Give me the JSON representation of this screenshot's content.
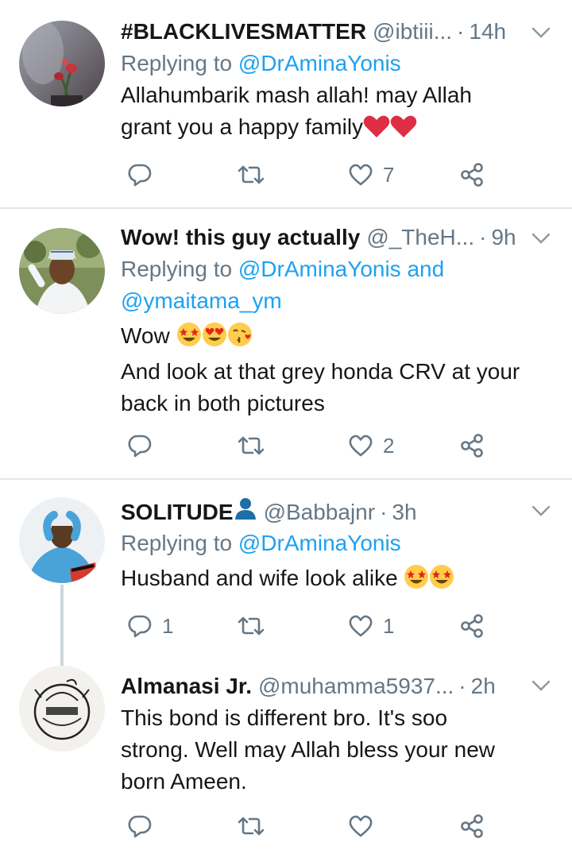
{
  "tweets": [
    {
      "display_name": "#BLACKLIVESMATTER",
      "handle": "@ibtiii...",
      "separator": "·",
      "time": "14h",
      "replying_to_label": "Replying to",
      "replying_to": "@DrAminaYonis",
      "text_lines": [
        "Allahumbarik mash allah! may Allah",
        "grant you a happy family"
      ],
      "trailing_emoji": [
        "red-heart",
        "red-heart"
      ],
      "reply_count": "",
      "retweet_count": "",
      "like_count": "7"
    },
    {
      "display_name": "Wow! this guy actually",
      "handle": "@_TheH...",
      "separator": "·",
      "time": "9h",
      "replying_to_label": "Replying to",
      "replying_to": "@DrAminaYonis",
      "replying_to_and": "and",
      "replying_to_second": "@ymaitama_ym",
      "text_lines": [
        "Wow",
        "And look at that grey honda CRV at your",
        "back in both pictures"
      ],
      "trailing_emoji": [
        "star-struck",
        "heart-eyes",
        "face-blowing-kiss"
      ],
      "reply_count": "",
      "retweet_count": "",
      "like_count": "2"
    },
    {
      "display_name": "SOLITUDE",
      "name_emoji": "bust-in-silhouette",
      "handle": "@Babbajnr",
      "separator": "·",
      "time": "3h",
      "replying_to_label": "Replying to",
      "replying_to": "@DrAminaYonis",
      "text_lines": [
        "Husband and wife look alike"
      ],
      "trailing_emoji": [
        "star-struck",
        "star-struck"
      ],
      "reply_count": "1",
      "retweet_count": "",
      "like_count": "1"
    },
    {
      "display_name": "Almanasi Jr.",
      "handle": "@muhamma5937...",
      "separator": "·",
      "time": "2h",
      "text_lines": [
        "This bond is different bro. It's soo",
        "strong. Well may Allah bless your new",
        "born Ameen."
      ],
      "reply_count": "",
      "retweet_count": "",
      "like_count": ""
    }
  ],
  "icons": {
    "reply": "reply-icon",
    "retweet": "retweet-icon",
    "like": "heart-icon",
    "share": "share-icon",
    "more": "chevron-down-icon"
  },
  "colors": {
    "link": "#1da1f2",
    "secondary_text": "#657786",
    "divider": "#e1e8ed",
    "thread_line": "#ccd6dd"
  }
}
